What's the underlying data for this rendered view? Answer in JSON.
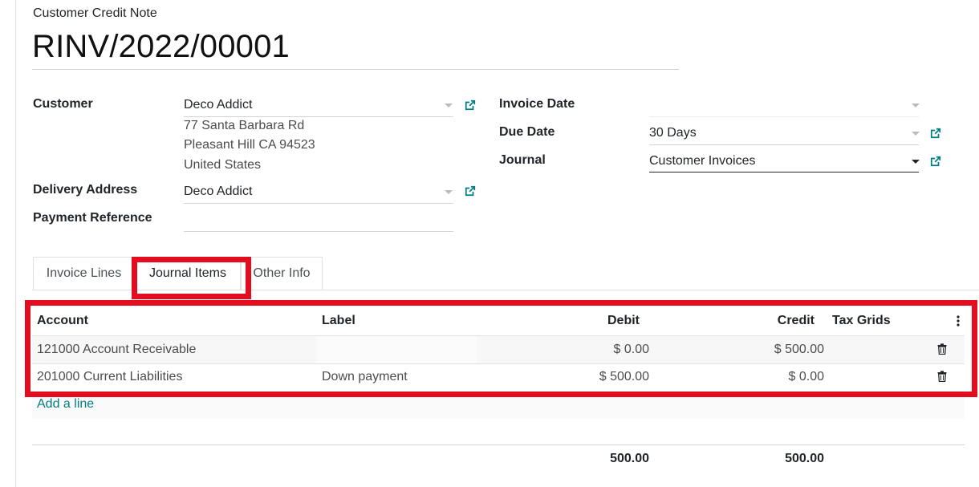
{
  "header": {
    "doc_type": "Customer Credit Note",
    "doc_name": "RINV/2022/00001"
  },
  "fields": {
    "customer_label": "Customer",
    "customer_value": "Deco Addict",
    "address_line1": "77 Santa Barbara Rd",
    "address_line2": "Pleasant Hill CA 94523",
    "address_line3": "United States",
    "delivery_label": "Delivery Address",
    "delivery_value": "Deco Addict",
    "payment_ref_label": "Payment Reference",
    "payment_ref_value": "",
    "invoice_date_label": "Invoice Date",
    "invoice_date_value": "",
    "due_date_label": "Due Date",
    "due_date_value": "30 Days",
    "journal_label": "Journal",
    "journal_value": "Customer Invoices"
  },
  "tabs": [
    {
      "label": "Invoice Lines",
      "active": false
    },
    {
      "label": "Journal Items",
      "active": true
    },
    {
      "label": "Other Info",
      "active": false
    }
  ],
  "table": {
    "columns": [
      "Account",
      "Label",
      "Debit",
      "Credit",
      "Tax Grids"
    ],
    "rows": [
      {
        "account": "121000 Account Receivable",
        "label": "",
        "debit": "$ 0.00",
        "credit": "$ 500.00",
        "tax_grids": ""
      },
      {
        "account": "201000 Current Liabilities",
        "label": "Down payment",
        "debit": "$ 500.00",
        "credit": "$ 0.00",
        "tax_grids": ""
      }
    ],
    "add_line": "Add a line",
    "total_debit": "500.00",
    "total_credit": "500.00"
  },
  "icons": {
    "external_link": "external-link-icon",
    "dropdown": "caret-down-icon",
    "delete": "trash-icon",
    "column_options": "kebab-vertical-icon"
  },
  "colors": {
    "highlight": "#e30d1f",
    "link": "#017e84",
    "external_link": "#017e84"
  }
}
